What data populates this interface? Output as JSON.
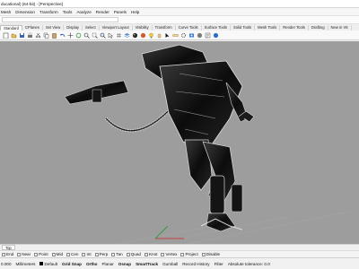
{
  "title_bar": {
    "text": "ducational) (64-bit) - [Perspective]"
  },
  "menu": [
    "Mesh",
    "Dimension",
    "Transform",
    "Tools",
    "Analyze",
    "Render",
    "Panels",
    "Help"
  ],
  "tabs": [
    {
      "label": "Standard",
      "active": true
    },
    {
      "label": "CPlanes"
    },
    {
      "label": "Set View"
    },
    {
      "label": "Display"
    },
    {
      "label": "Select"
    },
    {
      "label": "Viewport Layout"
    },
    {
      "label": "Visibility"
    },
    {
      "label": "Transform"
    },
    {
      "label": "Curve Tools"
    },
    {
      "label": "Surface Tools"
    },
    {
      "label": "Solid Tools"
    },
    {
      "label": "Mesh Tools"
    },
    {
      "label": "Render Tools"
    },
    {
      "label": "Drafting"
    },
    {
      "label": "New in V6"
    }
  ],
  "toolbar_icons": [
    "new-file-icon",
    "open-icon",
    "save-icon",
    "print-icon",
    "cut-icon",
    "copy-icon",
    "paste-icon",
    "undo-icon",
    "pan-icon",
    "rotate-icon",
    "zoom-icon",
    "zoom-window-icon",
    "zoom-extents-icon",
    "selection-icon",
    "grid-icon",
    "layer-icon",
    "render-sphere-icon",
    "material-icon",
    "light-bulb-icon",
    "hand-icon",
    "cursor-icon",
    "ruler-icon",
    "settings-icon",
    "render-preview-icon",
    "shade-icon",
    "properties-icon",
    "help-icon"
  ],
  "viewport": {
    "name": "Perspective",
    "background": "#9d9d9d"
  },
  "view_tabs": [
    "Top"
  ],
  "osnaps": [
    "End",
    "Near",
    "Point",
    "Mid",
    "Cen",
    "Int",
    "Perp",
    "Tan",
    "Quad",
    "Knot",
    "Vertex",
    "Project",
    "Disable"
  ],
  "status": {
    "coordinate": "0.000",
    "units": "Millimeters",
    "layer": "Default",
    "toggles": [
      {
        "label": "Grid Snap",
        "bold": true
      },
      {
        "label": "Ortho",
        "bold": true
      },
      {
        "label": "Planar",
        "bold": false
      },
      {
        "label": "Osnap",
        "bold": true
      },
      {
        "label": "SmartTrack",
        "bold": true
      },
      {
        "label": "Gumball",
        "bold": false
      },
      {
        "label": "Record History",
        "bold": false
      },
      {
        "label": "Filter",
        "bold": false
      }
    ],
    "tolerance": "Absolute tolerance: 0.0"
  }
}
